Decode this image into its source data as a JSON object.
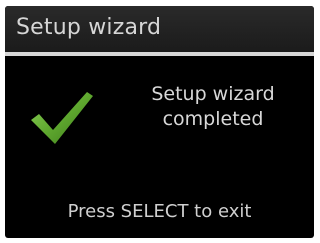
{
  "header": {
    "title": "Setup wizard"
  },
  "status": {
    "icon": "checkmark-icon",
    "icon_color": "#5fa82f",
    "line1": "Setup wizard",
    "line2": "completed"
  },
  "footer": {
    "hint": "Press SELECT to exit"
  },
  "colors": {
    "background": "#000000",
    "title_bar": "#1f1f1f",
    "text": "#d8d8d8",
    "divider": "#d7d7d7"
  }
}
